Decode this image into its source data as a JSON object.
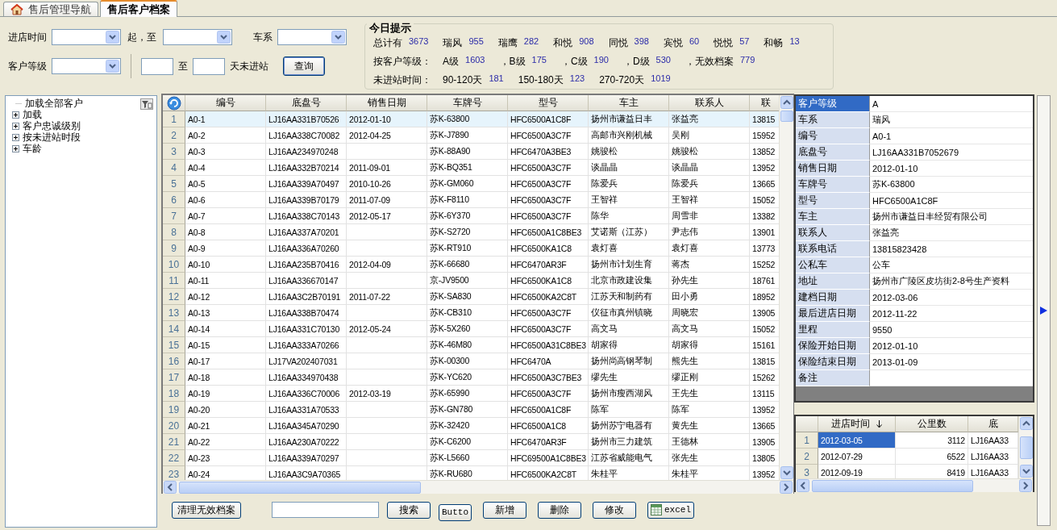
{
  "tabs": [
    {
      "label": "售后管理导航",
      "selected": false,
      "kind": "home"
    },
    {
      "label": "售后客户档案",
      "selected": true,
      "kind": "plain"
    }
  ],
  "filters": {
    "visit_time": "进店时间",
    "from_to": "起，至",
    "series": "车系",
    "customer_level": "客户等级",
    "to": "至",
    "days_no_visit": "天未进站",
    "query_button": "查询"
  },
  "today": {
    "title": "今日提示",
    "lines": [
      {
        "items": [
          {
            "label": "总计有",
            "value": "3673"
          },
          {
            "label": "瑞风",
            "value": "955"
          },
          {
            "label": "瑞鹰",
            "value": "282"
          },
          {
            "label": "和悦",
            "value": "908"
          },
          {
            "label": "同悦",
            "value": "398"
          },
          {
            "label": "宾悦",
            "value": "60"
          },
          {
            "label": "悦悦",
            "value": "57"
          },
          {
            "label": "和畅",
            "value": "13"
          }
        ]
      },
      {
        "prefix": "按客户等级：",
        "items": [
          {
            "label": "A级",
            "value": "1603"
          },
          {
            "label": "，B级",
            "value": "175"
          },
          {
            "label": "，C级",
            "value": "190"
          },
          {
            "label": "，D级",
            "value": "530"
          },
          {
            "label": "，无效档案",
            "value": "779"
          }
        ]
      },
      {
        "prefix": "未进站时间：",
        "items": [
          {
            "label": "90-120天",
            "value": "181"
          },
          {
            "label": "150-180天",
            "value": "123"
          },
          {
            "label": "270-720天",
            "value": "1019"
          }
        ]
      }
    ]
  },
  "tree": {
    "items": [
      {
        "label": "加载全部客户",
        "kind": "leaf"
      },
      {
        "label": "加载",
        "kind": "group",
        "expanded": false
      },
      {
        "label": "客户忠诚级别",
        "kind": "group",
        "expanded": false
      },
      {
        "label": "按未进站时段",
        "kind": "group",
        "expanded": false
      },
      {
        "label": "车龄",
        "kind": "group",
        "expanded": false
      }
    ]
  },
  "table": {
    "columns": [
      "编号",
      "底盘号",
      "销售日期",
      "车牌号",
      "型号",
      "车主",
      "联系人",
      "联"
    ],
    "rows": [
      {
        "n": "1",
        "selected": true,
        "cells": [
          "A0-1",
          "LJ16AA331B70526",
          "2012-01-10",
          "苏K-63800",
          "HFC6500A1C8F",
          "扬州市谦益日丰",
          "张益亮",
          "13815"
        ]
      },
      {
        "n": "2",
        "selected": false,
        "cells": [
          "A0-2",
          "LJ16AA338C70082",
          "2012-04-25",
          "苏K-J7890",
          "HFC6500A3C7F",
          "高邮市兴刚机械",
          "吴刚",
          "15952"
        ]
      },
      {
        "n": "3",
        "selected": false,
        "cells": [
          "A0-3",
          "LJ16AA234970248",
          null,
          "苏K-88A90",
          "HFC6470A3BE3",
          "姚骏松",
          "姚骏松",
          "13852"
        ]
      },
      {
        "n": "4",
        "selected": false,
        "cells": [
          "A0-4",
          "LJ16AA332B70214",
          "2011-09-01",
          "苏K-BQ351",
          "HFC6500A3C7F",
          "谈晶晶",
          "谈晶晶",
          "13952"
        ]
      },
      {
        "n": "5",
        "selected": false,
        "cells": [
          "A0-5",
          "LJ16AA339A70497",
          "2010-10-26",
          "苏K-GM060",
          "HFC6500A3C7F",
          "陈爱兵",
          "陈爱兵",
          "13665"
        ]
      },
      {
        "n": "6",
        "selected": false,
        "cells": [
          "A0-6",
          "LJ16AA339B70179",
          "2011-07-09",
          "苏K-F8110",
          "HFC6500A3C7F",
          "王智祥",
          "王智祥",
          "15052"
        ]
      },
      {
        "n": "7",
        "selected": false,
        "cells": [
          "A0-7",
          "LJ16AA338C70143",
          "2012-05-17",
          "苏K-6Y370",
          "HFC6500A3C7F",
          "陈华",
          "周雪非",
          "13382"
        ]
      },
      {
        "n": "8",
        "selected": false,
        "cells": [
          "A0-8",
          "LJ16AA337A70201",
          null,
          "苏K-S2720",
          "HFC6500A1C8BE3",
          "艾诺斯（江苏）",
          "尹志伟",
          "13901"
        ]
      },
      {
        "n": "9",
        "selected": false,
        "cells": [
          "A0-9",
          "LJ16AA336A70260",
          null,
          "苏K-RT910",
          "HFC6500KA1C8",
          "袁灯喜",
          "袁灯喜",
          "13773"
        ]
      },
      {
        "n": "10",
        "selected": false,
        "cells": [
          "A0-10",
          "LJ16AA235B70416",
          "2012-04-09",
          "苏K-66680",
          "HFC6470AR3F",
          "扬州市计划生育",
          "蒋杰",
          "15252"
        ]
      },
      {
        "n": "11",
        "selected": false,
        "cells": [
          "A0-11",
          "LJ16AA336670147",
          null,
          "京-JV9500",
          "HFC6500KA1C8",
          "北京市政建设集",
          "孙先生",
          "18761"
        ]
      },
      {
        "n": "12",
        "selected": false,
        "cells": [
          "A0-12",
          "LJ16AA3C2B70191",
          "2011-07-22",
          "苏K-SA830",
          "HFC6500KA2C8T",
          "江苏天和制药有",
          "田小勇",
          "18952"
        ]
      },
      {
        "n": "13",
        "selected": false,
        "cells": [
          "A0-13",
          "LJ16AA338B70474",
          null,
          "苏K-CB310",
          "HFC6500A3C7F",
          "仪征市真州镇晓",
          "周晓宏",
          "13905"
        ]
      },
      {
        "n": "14",
        "selected": false,
        "cells": [
          "A0-14",
          "LJ16AA331C70130",
          "2012-05-24",
          "苏K-5X260",
          "HFC6500A3C7F",
          "高文马",
          "高文马",
          "15052"
        ]
      },
      {
        "n": "15",
        "selected": false,
        "cells": [
          "A0-15",
          "LJ16AA333A70266",
          null,
          "苏K-46M80",
          "HFC6500A31C8BE3",
          "胡家得",
          "胡家得",
          "15161"
        ]
      },
      {
        "n": "16",
        "selected": false,
        "cells": [
          "A0-17",
          "LJ17VA202407031",
          null,
          "苏K-00300",
          "HFC6470A",
          "扬州尚高钢琴制",
          "熊先生",
          "13815"
        ]
      },
      {
        "n": "17",
        "selected": false,
        "cells": [
          "A0-18",
          "LJ16AA334970438",
          null,
          "苏K-YC620",
          "HFC6500A3C7BE3",
          "缪先生",
          "缪正刚",
          "15262"
        ]
      },
      {
        "n": "18",
        "selected": false,
        "cells": [
          "A0-19",
          "LJ16AA336C70006",
          "2012-03-19",
          "苏K-65990",
          "HFC6500A3C7F",
          "扬州市瘦西湖风",
          "王先生",
          "13115"
        ]
      },
      {
        "n": "19",
        "selected": false,
        "cells": [
          "A0-20",
          "LJ16AA331A70533",
          null,
          "苏K-GN780",
          "HFC6500A1C8F",
          "陈军",
          "陈军",
          "13952"
        ]
      },
      {
        "n": "20",
        "selected": false,
        "cells": [
          "A0-21",
          "LJ16AA345A70290",
          null,
          "苏K-32420",
          "HFC6500A1C8",
          "扬州苏宁电器有",
          "黄先生",
          "13665"
        ]
      },
      {
        "n": "21",
        "selected": false,
        "cells": [
          "A0-22",
          "LJ16AA230A70222",
          null,
          "苏K-C6200",
          "HFC6470AR3F",
          "扬州市三力建筑",
          "王德林",
          "13905"
        ]
      },
      {
        "n": "22",
        "selected": false,
        "cells": [
          "A0-23",
          "LJ16AA339A70297",
          null,
          "苏K-L5660",
          "HFC69500A1C8BE3",
          "江苏省威能电气",
          "张先生",
          "13805"
        ]
      },
      {
        "n": "23",
        "selected": false,
        "cells": [
          "A0-24",
          "LJ16AA3C9A70365",
          null,
          "苏K-RU680",
          "HFC6500KA2C8T",
          "朱桂平",
          "朱桂平",
          "13952"
        ]
      }
    ]
  },
  "detail": {
    "rows": [
      {
        "label": "客户等级",
        "value": "A",
        "selected": true
      },
      {
        "label": "车系",
        "value": "瑞风",
        "selected": false
      },
      {
        "label": "编号",
        "value": "A0-1",
        "selected": false
      },
      {
        "label": "底盘号",
        "value": "LJ16AA331B7052679",
        "selected": false
      },
      {
        "label": "销售日期",
        "value": "2012-01-10",
        "selected": false
      },
      {
        "label": "车牌号",
        "value": "苏K-63800",
        "selected": false
      },
      {
        "label": "型号",
        "value": "HFC6500A1C8F",
        "selected": false
      },
      {
        "label": "车主",
        "value": "扬州市谦益日丰经贸有限公司",
        "selected": false
      },
      {
        "label": "联系人",
        "value": "张益亮",
        "selected": false
      },
      {
        "label": "联系电话",
        "value": "13815823428",
        "selected": false
      },
      {
        "label": "公私车",
        "value": "公车",
        "selected": false
      },
      {
        "label": "地址",
        "value": "扬州市广陵区皮坊街2-8号生产资料",
        "selected": false
      },
      {
        "label": "建档日期",
        "value": "2012-03-06",
        "selected": false
      },
      {
        "label": "最后进店日期",
        "value": "2012-11-22",
        "selected": false
      },
      {
        "label": "里程",
        "value": "9550",
        "selected": false
      },
      {
        "label": "保险开始日期",
        "value": "2012-01-10",
        "selected": false
      },
      {
        "label": "保险结束日期",
        "value": "2013-01-09",
        "selected": false
      },
      {
        "label": "备注",
        "selected": false
      }
    ]
  },
  "visits": {
    "columns": [
      {
        "label": "进店时间",
        "sorted": true
      },
      {
        "label": "公里数",
        "sorted": false
      },
      {
        "label": "底",
        "sorted": false
      }
    ],
    "rows": [
      {
        "n": "1",
        "selected": true,
        "cells": [
          "2012-03-05",
          "3112",
          "LJ16AA33"
        ]
      },
      {
        "n": "2",
        "selected": false,
        "cells": [
          "2012-07-29",
          "6522",
          "LJ16AA33"
        ]
      },
      {
        "n": "3",
        "selected": false,
        "cells": [
          "2012-09-19",
          "8419",
          "LJ16AA33"
        ]
      }
    ]
  },
  "bottom_bar": {
    "items": [
      {
        "kind": "button",
        "label": "清理无效档案"
      },
      {
        "kind": "input"
      },
      {
        "kind": "button",
        "label": "搜索"
      },
      {
        "kind": "small",
        "label": "Butto"
      },
      {
        "kind": "button",
        "label": "新增"
      },
      {
        "kind": "button",
        "label": "删除"
      },
      {
        "kind": "button",
        "label": "修改"
      },
      {
        "kind": "excel",
        "label": "excel"
      }
    ]
  }
}
